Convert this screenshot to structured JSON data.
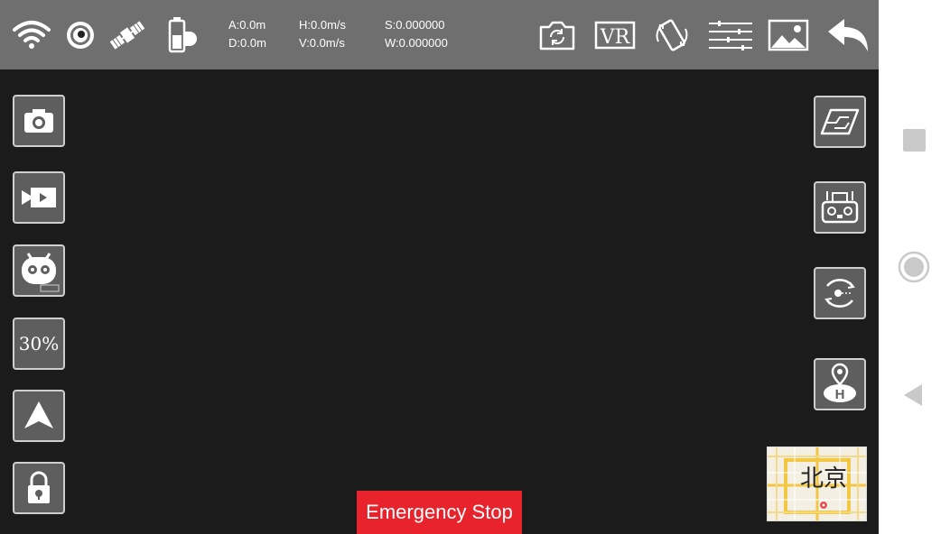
{
  "telemetry": {
    "altitude": "A:0.0m",
    "distance": "D:0.0m",
    "horizontal_speed": "H:0.0m/s",
    "vertical_speed": "V:0.0m/s",
    "latitude": "S:0.000000",
    "longitude": "W:0.000000"
  },
  "left_panel": {
    "speed_label": "30%"
  },
  "emergency_stop_label": "Emergency Stop",
  "minimap": {
    "city_label": "北京"
  },
  "icons": {
    "status": [
      "wifi-icon",
      "camera-lens-icon",
      "satellite-icon",
      "battery-icon"
    ],
    "top_right": [
      "switch-camera-icon",
      "vr-icon",
      "rotate-device-icon",
      "settings-sliders-icon",
      "gallery-icon",
      "back-icon"
    ],
    "left": [
      "camera-icon",
      "video-icon",
      "robot-face-icon",
      "speed-button",
      "takeoff-arrow-icon",
      "lock-icon"
    ],
    "right": [
      "flight-path-icon",
      "remote-controller-icon",
      "orbit-icon",
      "return-home-icon"
    ]
  },
  "colors": {
    "topbar": "#6f6f6f",
    "viewport": "#1b1b1b",
    "emergency": "#e8232c"
  }
}
